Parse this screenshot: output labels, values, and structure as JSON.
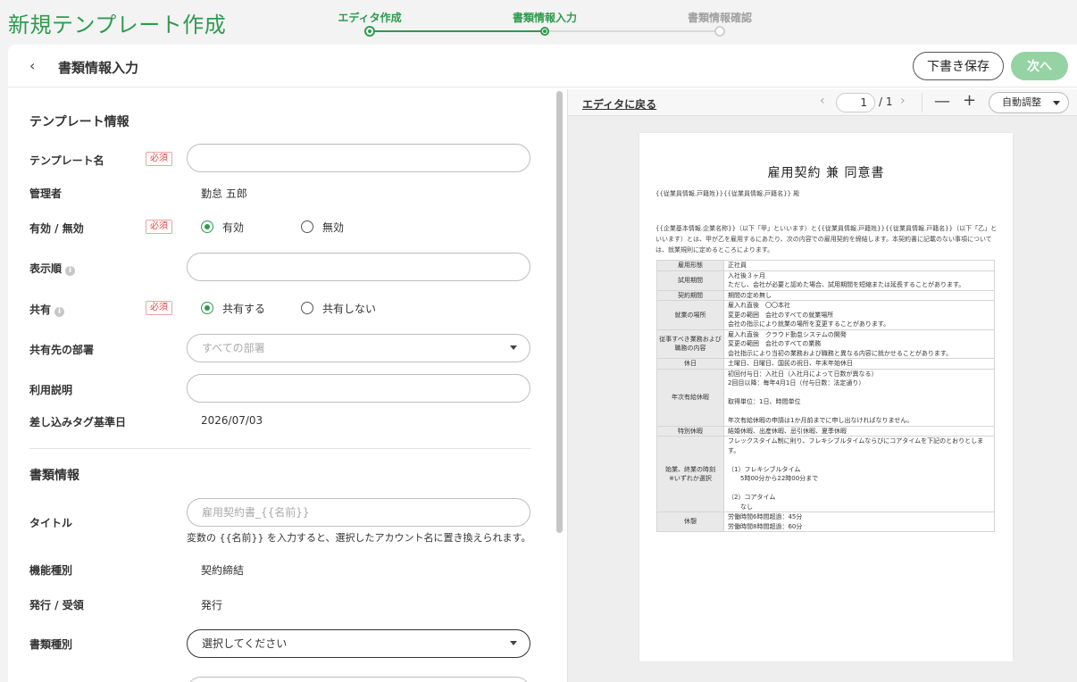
{
  "app": {
    "title": "新規テンプレート作成"
  },
  "stepper": {
    "steps": [
      {
        "label": "エディタ作成"
      },
      {
        "label": "書類情報入力"
      },
      {
        "label": "書類情報確認"
      }
    ]
  },
  "header": {
    "back_glyph": "‹",
    "title": "書類情報入力",
    "draft_label": "下書き保存",
    "next_label": "次へ"
  },
  "form": {
    "template_section": "テンプレート情報",
    "required_badge": "必須",
    "template_name_label": "テンプレート名",
    "template_name_value": "",
    "manager_label": "管理者",
    "manager_value": "勤怠 五郎",
    "status_label": "有効 / 無効",
    "status_options": [
      "有効",
      "無効"
    ],
    "display_order_label": "表示順",
    "display_order_value": "",
    "share_label": "共有",
    "share_options": [
      "共有する",
      "共有しない"
    ],
    "share_dept_label": "共有先の部署",
    "share_dept_placeholder": "すべての部署",
    "usage_label": "利用説明",
    "usage_value": "",
    "tag_date_label": "差し込みタグ基準日",
    "tag_date_value": "2026/07/03",
    "doc_section": "書類情報",
    "title_label": "タイトル",
    "title_placeholder": "雇用契約書_{{名前}}",
    "title_hint": "変数の {{名前}} を入力すると、選択したアカウント名に置き換えられます。",
    "function_label": "機能種別",
    "function_value": "契約締結",
    "issue_label": "発行 / 受領",
    "issue_value": "発行",
    "doc_type_label": "書類種別",
    "doc_type_placeholder": "選択してください",
    "info_glyph": "i"
  },
  "preview": {
    "back_to_editor": "エディタに戻る",
    "prev_glyph": "‹",
    "next_glyph": "›",
    "page_current": "1",
    "page_total": "/ 1",
    "zoom_out_glyph": "—",
    "zoom_in_glyph": "+",
    "zoom_mode": "自動調整",
    "doc": {
      "title": "雇用契約 兼 同意書",
      "addressee": "{{従業員情報.戸籍姓}}{{従業員情報.戸籍名}} 殿",
      "intro": "{{企業基本情報.企業名称}}（以下「甲」といいます）と{{従業員情報.戸籍姓}}{{従業員情報.戸籍名}}（以下「乙」といいます）とは、甲が乙を雇用するにあたり、次の内容での雇用契約を締結します。本契約書に記載のない事項については、就業規則に定めるところによります。",
      "rows": [
        {
          "k": "雇用形態",
          "v": "正社員"
        },
        {
          "k": "試用期間",
          "v": "入社後３ヶ月\nただし、会社が必要と認めた場合、試用期間を短縮または延長することがあります。"
        },
        {
          "k": "契約期間",
          "v": "期間の定め無し"
        },
        {
          "k": "就業の場所",
          "v": "雇入れ直後　〇〇本社\n変更の範囲　会社のすべての就業場所\n会社の指示により就業の場所を変更することがあります。"
        },
        {
          "k": "従事すべき業務および職務の内容",
          "v": "雇入れ直後　クラウド勤怠システムの開発\n変更の範囲　会社のすべての業務\n会社指示により当初の業務および職務と異なる内容に就かせることがあります。"
        },
        {
          "k": "休日",
          "v": "土曜日、日曜日、国民の祝日、年末年始休日"
        },
        {
          "k": "年次有給休暇",
          "v": "初回付与日：入社日（入社月によって日数が異なる）\n2回目以降：毎年4月1日（付与日数：法定通り）\n\n取得単位：1日、時間単位\n\n年次有給休暇の申請は1か月前までに申し出なければなりません。"
        },
        {
          "k": "特別休暇",
          "v": "結婚休暇、出産休暇、忌引休暇、夏季休暇"
        },
        {
          "k": "始業、終業の時刻\n※いずれか選択",
          "v": "フレックスタイム制に則り、フレキシブルタイムならびにコアタイムを下記のとおりとします。\n\n（1）フレキシブルタイム\n　　5時00分から22時00分まで\n\n（2）コアタイム\n　　なし"
        },
        {
          "k": "休憩",
          "v": "労働時間6時間超過：45分\n労働時間8時間超過：60分"
        }
      ]
    }
  },
  "colors": {
    "brand": "#2e9b4e",
    "next_disabled": "#95d3a4",
    "required": "#e64545"
  }
}
